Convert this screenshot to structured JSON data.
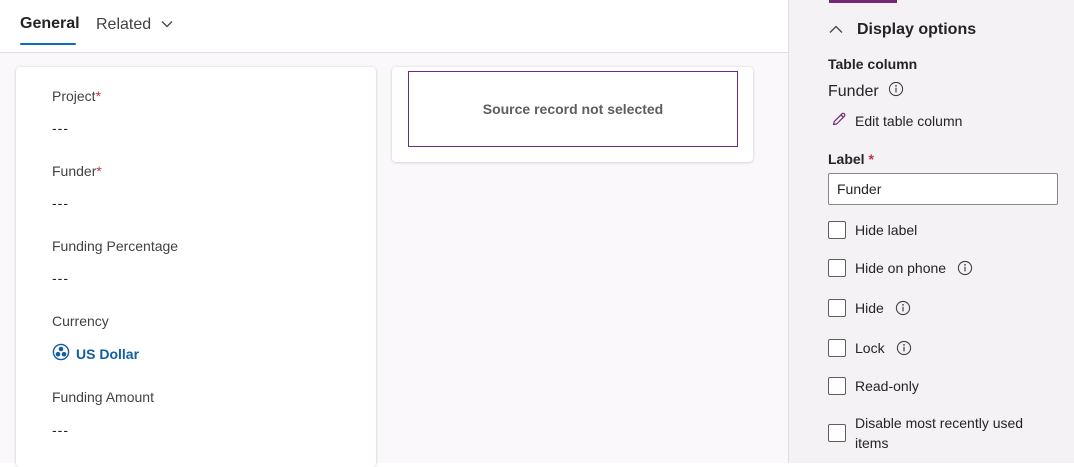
{
  "tabs": {
    "general": "General",
    "related": "Related"
  },
  "fields": [
    {
      "label": "Project",
      "required": "*",
      "value": "---"
    },
    {
      "label": "Funder",
      "required": "*",
      "value": "---"
    },
    {
      "label": "Funding Percentage",
      "value": "---"
    },
    {
      "label": "Currency",
      "value": "US Dollar"
    },
    {
      "label": "Funding Amount",
      "value": "---"
    }
  ],
  "source_record": {
    "message": "Source record not selected"
  },
  "panel": {
    "section_title": "Display options",
    "table_column_heading": "Table column",
    "column_name": "Funder",
    "edit_column_link": "Edit table column",
    "label_heading": "Label",
    "label_required": "*",
    "label_value": "Funder",
    "options": [
      {
        "label": "Hide label",
        "checked": false,
        "info": false
      },
      {
        "label": "Hide on phone",
        "checked": false,
        "info": true
      },
      {
        "label": "Hide",
        "checked": false,
        "info": true
      },
      {
        "label": "Lock",
        "checked": false,
        "info": true
      },
      {
        "label": "Read-only",
        "checked": false,
        "info": false
      },
      {
        "label": "Disable most recently used items",
        "checked": false,
        "info": false
      }
    ]
  },
  "colors": {
    "accent": "#742774",
    "tab_underline": "#0f6cbd",
    "link": "#115ea3",
    "required": "#c4314b"
  }
}
